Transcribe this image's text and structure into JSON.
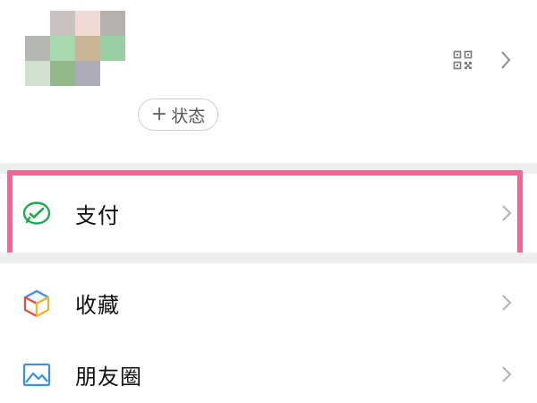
{
  "profile": {
    "avatar_colors": [
      "#ffffff",
      "#c9c1c0",
      "#efd9d3",
      "#b6b0ad",
      "#b4b8b3",
      "#a8d8ad",
      "#c9b596",
      "#98cfa4",
      "#d1e0cf",
      "#93b98a",
      "#acacb8",
      "#ffffff"
    ],
    "status_label": "状态"
  },
  "menu": {
    "pay_label": "支付",
    "favorites_label": "收藏",
    "moments_label": "朋友圈"
  },
  "colors": {
    "highlight": "#ec6a92",
    "pay_icon": "#1aad4f",
    "background_gap": "#ededed"
  }
}
